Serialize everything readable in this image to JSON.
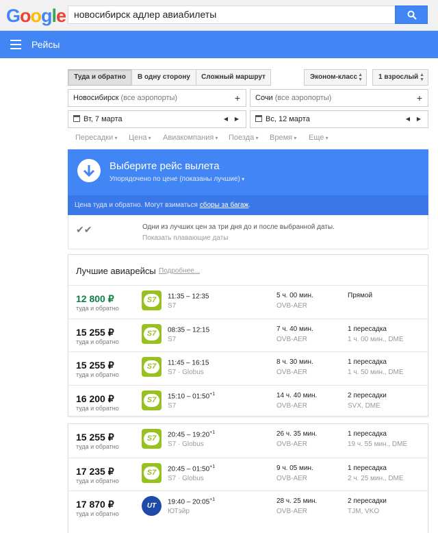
{
  "header": {
    "logo_letters": [
      {
        "ch": "G",
        "color": "#4285f4"
      },
      {
        "ch": "o",
        "color": "#ea4335"
      },
      {
        "ch": "o",
        "color": "#fbbc05"
      },
      {
        "ch": "g",
        "color": "#4285f4"
      },
      {
        "ch": "l",
        "color": "#34a853"
      },
      {
        "ch": "e",
        "color": "#ea4335"
      }
    ],
    "search_value": "новосибирск адлер авиабилеты"
  },
  "nav": {
    "title": "Рейсы"
  },
  "trip_type": {
    "options": [
      "Туда и обратно",
      "В одну сторону",
      "Сложный маршрут"
    ],
    "selected": 0
  },
  "cabin": "Эконом-класс",
  "passengers": "1 взрослый",
  "origin": {
    "city": "Новосибирск",
    "hint": "(все аэропорты)"
  },
  "destination": {
    "city": "Сочи",
    "hint": "(все аэропорты)"
  },
  "depart_date": "Вт, 7 марта",
  "return_date": "Вс, 12 марта",
  "filters": [
    "Пересадки",
    "Цена",
    "Авиакомпания",
    "Поезда",
    "Время",
    "Еще"
  ],
  "panel": {
    "title": "Выберите рейс вылета",
    "subtitle": "Упорядочено по цене (показаны лучшие)",
    "note": "Цена туда и обратно. Могут взиматься ",
    "note_link": "сборы за багаж",
    "note_end": "."
  },
  "notice": {
    "line1": "Одни из лучших цен за три дня до и после выбранной даты.",
    "line2": "Показать плавающие даты"
  },
  "best": {
    "heading": "Лучшие авиарейсы",
    "more": "Подробнее..."
  },
  "price_type": "туда и обратно",
  "flights": [
    {
      "price": "12 800 ₽",
      "best": true,
      "logo": "S7",
      "time": "11:35 – 12:35",
      "plus": "",
      "airline": "S7",
      "duration": "5 ч. 00 мин.",
      "route": "OVB-AER",
      "stops": "Прямой",
      "stops_detail": ""
    },
    {
      "price": "15 255 ₽",
      "best": false,
      "logo": "S7",
      "time": "08:35 – 12:15",
      "plus": "",
      "airline": "S7",
      "duration": "7 ч. 40 мин.",
      "route": "OVB-AER",
      "stops": "1 пересадка",
      "stops_detail": "1 ч. 00 мин., DME"
    },
    {
      "price": "15 255 ₽",
      "best": false,
      "logo": "S7",
      "time": "11:45 – 16:15",
      "plus": "",
      "airline": "S7 · Globus",
      "duration": "8 ч. 30 мин.",
      "route": "OVB-AER",
      "stops": "1 пересадка",
      "stops_detail": "1 ч. 50 мин., DME"
    },
    {
      "price": "16 200 ₽",
      "best": false,
      "logo": "S7",
      "time": "15:10 – 01:50",
      "plus": "+1",
      "airline": "S7",
      "duration": "14 ч. 40 мин.",
      "route": "OVB-AER",
      "stops": "2 пересадки",
      "stops_detail": "SVX, DME"
    },
    {
      "price": "15 255 ₽",
      "best": false,
      "logo": "S7",
      "time": "20:45 – 19:20",
      "plus": "+1",
      "airline": "S7 · Globus",
      "duration": "26 ч. 35 мин.",
      "route": "OVB-AER",
      "stops": "1 пересадка",
      "stops_detail": "19 ч. 55 мин., DME"
    },
    {
      "price": "17 235 ₽",
      "best": false,
      "logo": "S7",
      "time": "20:45 – 01:50",
      "plus": "+1",
      "airline": "S7 · Globus",
      "duration": "9 ч. 05 мин.",
      "route": "OVB-AER",
      "stops": "1 пересадка",
      "stops_detail": "2 ч. 25 мин., DME"
    },
    {
      "price": "17 870 ₽",
      "best": false,
      "logo": "UT",
      "time": "19:40 – 20:05",
      "plus": "+1",
      "airline": "ЮТэйр",
      "duration": "28 ч. 25 мин.",
      "route": "OVB-AER",
      "stops": "2 пересадки",
      "stops_detail": "TJM, VKO"
    }
  ],
  "colors": {
    "brand_blue": "#4285f4",
    "best_price": "#0b8043",
    "s7": "#96c11f",
    "utair": "#1f4aa8"
  }
}
